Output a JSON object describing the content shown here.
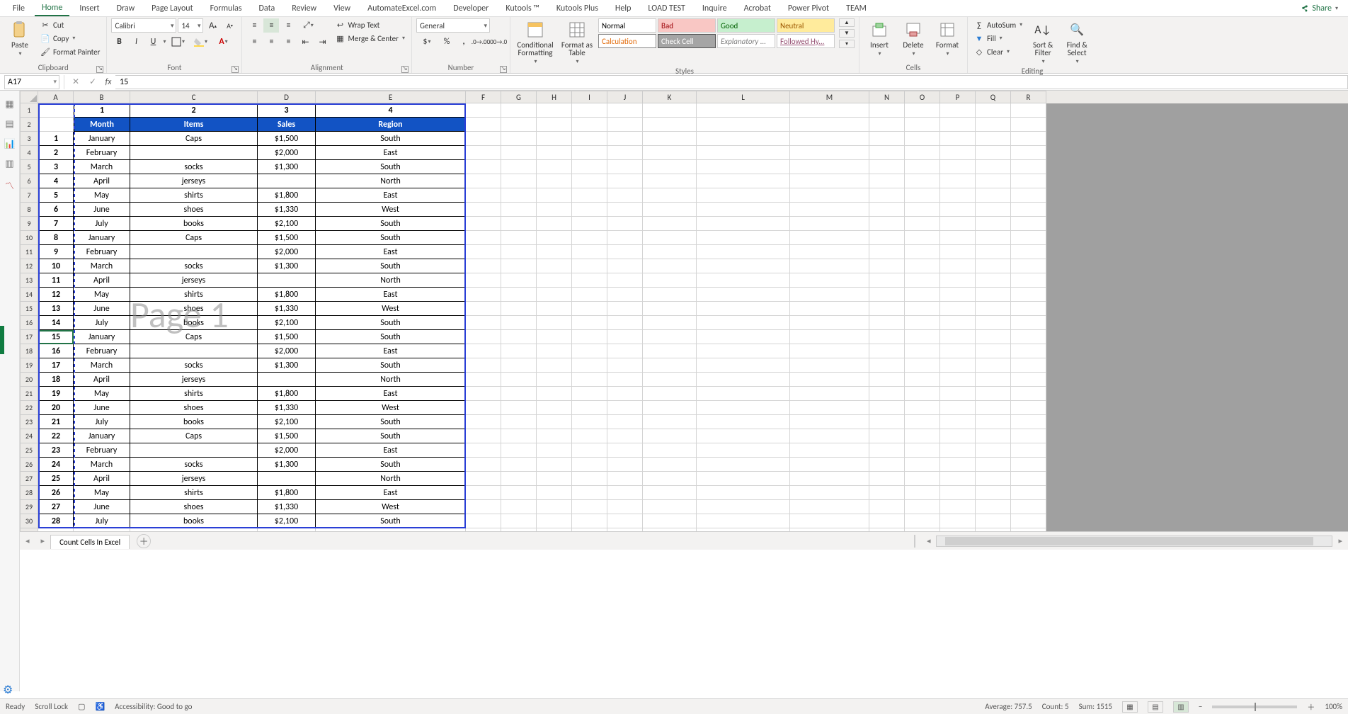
{
  "menu": {
    "tabs": [
      "File",
      "Home",
      "Insert",
      "Draw",
      "Page Layout",
      "Formulas",
      "Data",
      "Review",
      "View",
      "AutomateExcel.com",
      "Developer",
      "Kutools ™",
      "Kutools Plus",
      "Help",
      "LOAD TEST",
      "Inquire",
      "Acrobat",
      "Power Pivot",
      "TEAM"
    ],
    "active": 1,
    "share": "Share"
  },
  "ribbon": {
    "clipboard": {
      "label": "Clipboard",
      "paste": "Paste",
      "cut": "Cut",
      "copy": "Copy",
      "fp": "Format Painter"
    },
    "font": {
      "label": "Font",
      "name": "Calibri",
      "size": "14",
      "btns": {
        "b": "B",
        "i": "I",
        "u": "U"
      },
      "grow": "A",
      "shrink": "A"
    },
    "alignment": {
      "label": "Alignment",
      "wrap": "Wrap Text",
      "merge": "Merge & Center"
    },
    "number": {
      "label": "Number",
      "format": "General"
    },
    "styles": {
      "label": "Styles",
      "cf": "Conditional\nFormatting",
      "fat": "Format as\nTable",
      "cells": [
        {
          "t": "Normal",
          "bg": "#fff",
          "c": "#000"
        },
        {
          "t": "Bad",
          "bg": "#f9c7c4",
          "c": "#9c0006"
        },
        {
          "t": "Good",
          "bg": "#c6efce",
          "c": "#006100"
        },
        {
          "t": "Neutral",
          "bg": "#ffeb9c",
          "c": "#9c5700"
        },
        {
          "t": "Calculation",
          "bg": "#fff",
          "c": "#e26b0a",
          "bd": "#888"
        },
        {
          "t": "Check Cell",
          "bg": "#a5a5a5",
          "c": "#fff",
          "bd": "#555"
        },
        {
          "t": "Explanatory ...",
          "bg": "#fff",
          "c": "#7f7f7f",
          "it": true
        },
        {
          "t": "Followed Hy...",
          "bg": "#fff",
          "c": "#954f72",
          "ul": true
        }
      ]
    },
    "cells": {
      "label": "Cells",
      "insert": "Insert",
      "delete": "Delete",
      "format": "Format"
    },
    "editing": {
      "label": "Editing",
      "autosum": "AutoSum",
      "fill": "Fill",
      "clear": "Clear",
      "sort": "Sort &\nFilter",
      "find": "Find &\nSelect"
    }
  },
  "namebox": "A17",
  "formula": "15",
  "columns": [
    "A",
    "B",
    "C",
    "D",
    "E",
    "F",
    "G",
    "H",
    "I",
    "J",
    "K",
    "L",
    "M",
    "N",
    "O",
    "P",
    "Q",
    "R"
  ],
  "headerNums": [
    "1",
    "2",
    "3",
    "4"
  ],
  "tableHeaders": [
    "Month",
    "Items",
    "Sales",
    "Region"
  ],
  "rows": [
    {
      "n": "1",
      "m": "January",
      "i": "Caps",
      "s": "$1,500",
      "r": "South"
    },
    {
      "n": "2",
      "m": "February",
      "i": "",
      "s": "$2,000",
      "r": "East"
    },
    {
      "n": "3",
      "m": "March",
      "i": "socks",
      "s": "$1,300",
      "r": "South"
    },
    {
      "n": "4",
      "m": "April",
      "i": "jerseys",
      "s": "",
      "r": "North"
    },
    {
      "n": "5",
      "m": "May",
      "i": "shirts",
      "s": "$1,800",
      "r": "East"
    },
    {
      "n": "6",
      "m": "June",
      "i": "shoes",
      "s": "$1,330",
      "r": "West"
    },
    {
      "n": "7",
      "m": "July",
      "i": "books",
      "s": "$2,100",
      "r": "South"
    },
    {
      "n": "8",
      "m": "January",
      "i": "Caps",
      "s": "$1,500",
      "r": "South"
    },
    {
      "n": "9",
      "m": "February",
      "i": "",
      "s": "$2,000",
      "r": "East"
    },
    {
      "n": "10",
      "m": "March",
      "i": "socks",
      "s": "$1,300",
      "r": "South"
    },
    {
      "n": "11",
      "m": "April",
      "i": "jerseys",
      "s": "",
      "r": "North"
    },
    {
      "n": "12",
      "m": "May",
      "i": "shirts",
      "s": "$1,800",
      "r": "East"
    },
    {
      "n": "13",
      "m": "June",
      "i": "shoes",
      "s": "$1,330",
      "r": "West"
    },
    {
      "n": "14",
      "m": "July",
      "i": "books",
      "s": "$2,100",
      "r": "South"
    },
    {
      "n": "15",
      "m": "January",
      "i": "Caps",
      "s": "$1,500",
      "r": "South"
    },
    {
      "n": "16",
      "m": "February",
      "i": "",
      "s": "$2,000",
      "r": "East"
    },
    {
      "n": "17",
      "m": "March",
      "i": "socks",
      "s": "$1,300",
      "r": "South"
    },
    {
      "n": "18",
      "m": "April",
      "i": "jerseys",
      "s": "",
      "r": "North"
    },
    {
      "n": "19",
      "m": "May",
      "i": "shirts",
      "s": "$1,800",
      "r": "East"
    },
    {
      "n": "20",
      "m": "June",
      "i": "shoes",
      "s": "$1,330",
      "r": "West"
    },
    {
      "n": "21",
      "m": "July",
      "i": "books",
      "s": "$2,100",
      "r": "South"
    },
    {
      "n": "22",
      "m": "January",
      "i": "Caps",
      "s": "$1,500",
      "r": "South"
    },
    {
      "n": "23",
      "m": "February",
      "i": "",
      "s": "$2,000",
      "r": "East"
    },
    {
      "n": "24",
      "m": "March",
      "i": "socks",
      "s": "$1,300",
      "r": "South"
    },
    {
      "n": "25",
      "m": "April",
      "i": "jerseys",
      "s": "",
      "r": "North"
    },
    {
      "n": "26",
      "m": "May",
      "i": "shirts",
      "s": "$1,800",
      "r": "East"
    },
    {
      "n": "27",
      "m": "June",
      "i": "shoes",
      "s": "$1,330",
      "r": "West"
    },
    {
      "n": "28",
      "m": "July",
      "i": "books",
      "s": "$2,100",
      "r": "South"
    }
  ],
  "watermark": "Page 1",
  "sheet_tab": "Count Cells In Excel",
  "status": {
    "ready": "Ready",
    "scroll": "Scroll Lock",
    "acc": "Accessibility: Good to go",
    "avg": "Average: 757.5",
    "cnt": "Count: 5",
    "sum": "Sum: 1515",
    "zoom": "100%"
  }
}
